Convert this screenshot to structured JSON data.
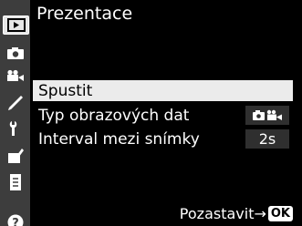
{
  "title": "Prezentace",
  "sidebar": {
    "icons": [
      "playback-icon",
      "camera-icon",
      "movie-camera-icon",
      "pencil-icon",
      "wrench-icon",
      "retouch-icon",
      "my-menu-icon",
      "help-icon"
    ],
    "active_tab": "playback-icon"
  },
  "menu": {
    "items": [
      {
        "label": "Spustit",
        "selected": true
      },
      {
        "label": "Typ obrazových dat",
        "value_icon": "photo-and-movie-icon"
      },
      {
        "label": "Interval mezi snímky",
        "value": "2s"
      }
    ]
  },
  "footer": {
    "pause_label": "Pozastavit",
    "arrow": "→",
    "ok_label": "OK"
  },
  "colors": {
    "background": "#000000",
    "sidebar": "#3d3d3d",
    "selected_row": "#ebebeb",
    "value_box": "#2f2f2f"
  }
}
